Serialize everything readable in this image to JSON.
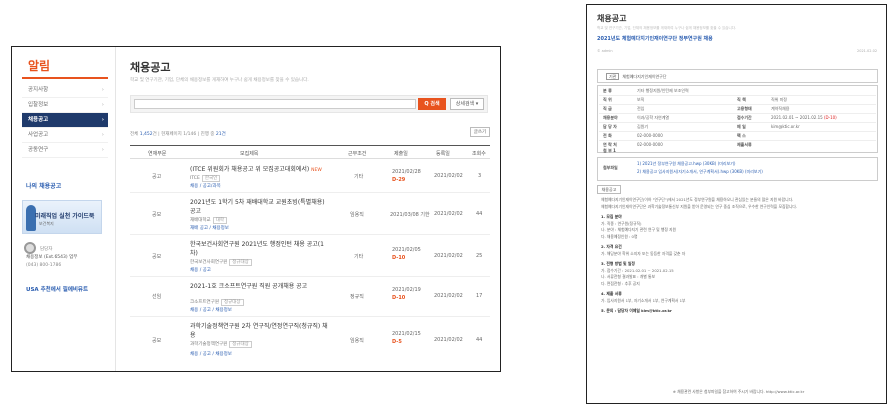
{
  "left": {
    "logo": "알림",
    "sidebar": [
      {
        "label": "공지사항"
      },
      {
        "label": "입찰정보"
      },
      {
        "label": "채용공고"
      },
      {
        "label": "사업공고"
      },
      {
        "label": "공동연구"
      }
    ],
    "mine": "나의 채용공고",
    "banner": {
      "title": "미래직업 실천 가이드북",
      "sub": "보건복지"
    },
    "contact": {
      "l1": "담당자",
      "l2": "채용정보 (Ext.6543) 업무",
      "l3": "(043) 800-1786"
    },
    "plus": "USA 추천에서 필에비뮤트",
    "title": "채용공고",
    "desc": "학교 및 연구기관, 기업, 단체의 채용정보를 게재하여 누구나 쉽게 채용정보를 찾을 수 있습니다.",
    "search": {
      "btn": "Q 검색",
      "adv": "상세검색 ▾"
    },
    "count": {
      "label": "전체",
      "n": "1,452",
      "mid": "건 | 현재페이지 1/146 | 진행 중 ",
      "cur": "21건"
    },
    "print": "글쓰기",
    "cols": {
      "type": "연재부문",
      "title": "모집제목",
      "form": "근무조건",
      "reg": "제출일",
      "end": "등록일",
      "views": "조회수"
    },
    "rows": [
      {
        "type": "공고",
        "title": "(ITCE 위원회가 채용공고 위 모집공고대회에서) ",
        "new": "NEW",
        "org": "ITCE",
        "tag": "한국인",
        "links": "채용 / 공고/과목",
        "form": "기타",
        "reg": "2021/02/28",
        "dday": "D-29",
        "end": "2021/02/02",
        "views": "3"
      },
      {
        "type": "공모",
        "title": "2021년도 1학기 5차 재배대학교 교원초빙(특별채용) 공고",
        "new": "",
        "org": "재배대학교",
        "tag": "대학",
        "links": "재배 공고 / 채용정보",
        "form": "임용직",
        "reg": "2021/03/08 기한",
        "dday": "",
        "end": "2021/02/02",
        "views": "44"
      },
      {
        "type": "공모",
        "title": "한국보건사회연구원 2021년도 행정인턴 채용 공고(1차)",
        "new": "",
        "org": "한국보건사회연구원",
        "tag": "정규대상",
        "links": "채용 / 공고",
        "form": "기타",
        "reg": "2021/02/05",
        "dday": "D-10",
        "end": "2021/02/02",
        "views": "25"
      },
      {
        "type": "선임",
        "title": "2021-1호 크소프트연구원 직원 공개채용 공고",
        "new": "",
        "org": "크소프트연구원",
        "tag": "정규대상",
        "links": "채용 / 공고 / 채용정보",
        "form": "정규직",
        "reg": "2021/02/19",
        "dday": "D-10",
        "end": "2021/02/02",
        "views": "17"
      },
      {
        "type": "공모",
        "title": "과학기술정책연구원 2차 연구직/연정연구직(청규직) 채용",
        "new": "",
        "org": "과학기술정책연구원",
        "tag": "정규대상",
        "links": "채용 / 공고 / 채용정보",
        "form": "임용직",
        "reg": "2021/02/15",
        "dday": "D-5",
        "end": "2021/02/02",
        "views": "44"
      }
    ]
  },
  "right": {
    "title": "채용공고",
    "sub": "학교 및 연구기관, 기업, 단체의 채용정보를 게재하여 누구나 쉽게 채용정보를 찾을 수 있습니다.",
    "post": "2021년도 체험예다지기인재이연구단 정부연구원 채용",
    "date": "© admin",
    "date2": "2021.02.02",
    "org_code": "기관",
    "org": "체험예다지기인재이연구단",
    "info": [
      {
        "l": "분 류",
        "v": "기타 행정지원/인턴제 보조인력"
      },
      {
        "l": "직 위",
        "v": "보직",
        "l2": "직 책",
        "v2": "직위 미정"
      },
      {
        "l": "직 급",
        "v": "전임",
        "l2": "고용형태",
        "v2": "계약직채용"
      },
      {
        "l": "채용분야",
        "v": "이과/공학 자연계열",
        "l2": "접수기간",
        "v2": "2021.02.01 ~ 2021.02.15",
        "red": "(D-10)"
      },
      {
        "l": "담 당 자",
        "v": "김원기",
        "l2": "메 일",
        "v2": "kim@ktic.or.kr"
      },
      {
        "l": "전 화",
        "v": "02-000-0000",
        "l2": "팩 스",
        "v2": ""
      },
      {
        "l": "연 락 처",
        "v": "02-000-0000",
        "l2": "제출서류",
        "v2": ""
      },
      {
        "l": "첨 부 1",
        "v": ""
      }
    ],
    "attach_label": "첨부파일",
    "attach": [
      "1) 2021년 정부연구원 채용공고.hwp (30KB) (미리보기)",
      "2) 채용공고 입사지원서(자기소개서, 연구계획서).hwp (30KB) (미리보기)"
    ],
    "body_label": "채용공고",
    "body": [
      "체험예다지기인재이연구단(이하 \"연구단\")에서 2021년도 정부연구원을 채용하오니 관심있는 분들의 많은 지원 바랍니다.",
      "체험예다지기인재이연구단은 과학기술정보통신부 지원을 받아 운영되는 연구 중심 조직으로, 우수한 연구인력을 모집합니다.",
      "1. 모집 분야",
      "  가. 직종 : 연구원(정규직)",
      "  나. 분야 : 체험예다지기 관련 연구 및 행정 지원",
      "  다. 채용예정인원 : 0명",
      "2. 자격 요건",
      "  가. 해당분야 학위 소지자 또는 동등한 자격을 갖춘 자",
      "3. 전형 방법 및 일정",
      "  가. 접수기간 : 2021.02.01 ~ 2021.02.15",
      "  나. 서류전형 결과발표 : 개별 통보",
      "  다. 면접전형 : 추후 공지",
      "4. 제출 서류",
      "  가. 입사지원서 1부, 자기소개서 1부, 연구계획서 1부",
      "5. 문의 : 담당자 이메일 kim@ktic.or.kr"
    ],
    "footer": "※ 채용관련 사항은 첨부파일을 참고하여 주시기 바랍니다. http://www.ktic.or.kr"
  }
}
